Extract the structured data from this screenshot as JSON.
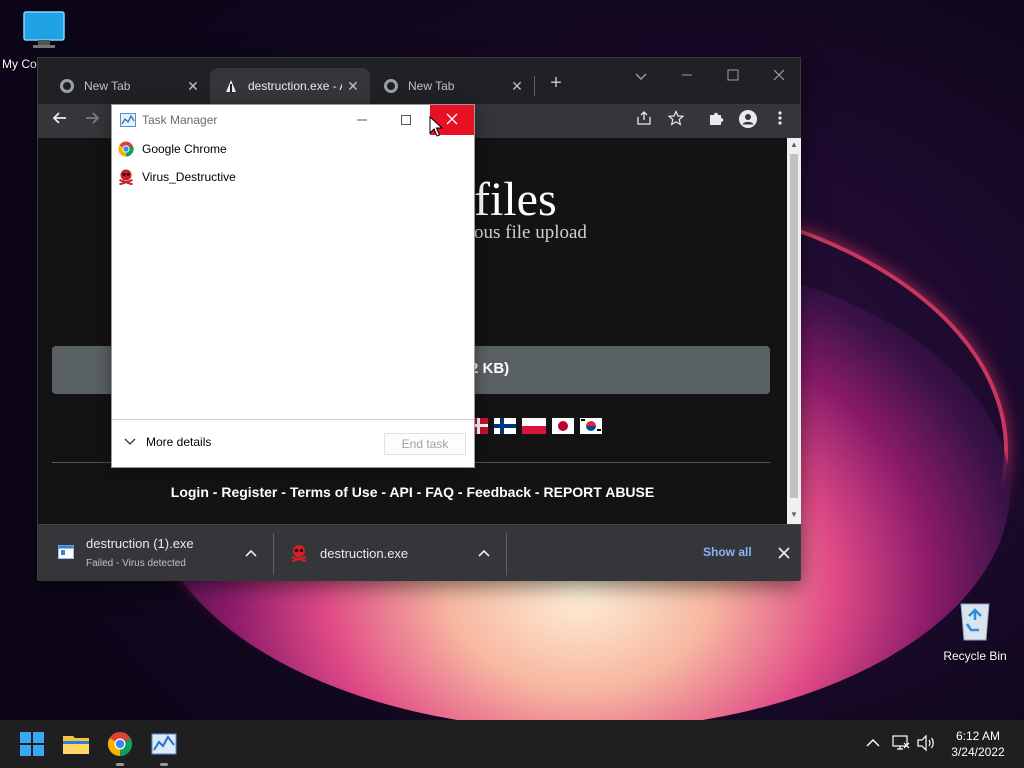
{
  "desktop": {
    "icons": [
      {
        "label": "My Co"
      },
      {
        "label": "Recycle Bin"
      }
    ]
  },
  "chrome": {
    "tabs": [
      {
        "title": "New Tab",
        "close": "✕"
      },
      {
        "title": "destruction.exe - A",
        "close": "✕"
      },
      {
        "title": "New Tab",
        "close": "✕"
      }
    ],
    "new_tab": "+",
    "page": {
      "title_partial": "files",
      "subtitle_partial": "ous file upload",
      "upload_text_partial": "2 KB)",
      "footer_links": [
        "Login",
        "Register",
        "Terms of Use",
        "API",
        "FAQ",
        "Feedback",
        "REPORT ABUSE"
      ],
      "footer_separator": " - "
    },
    "downloads": {
      "items": [
        {
          "name": "destruction (1).exe",
          "status": "Failed - Virus detected"
        },
        {
          "name": "destruction.exe",
          "status": ""
        }
      ],
      "show_all": "Show all"
    }
  },
  "task_manager": {
    "title": "Task Manager",
    "processes": [
      {
        "name": "Google Chrome",
        "icon": "chrome-icon"
      },
      {
        "name": "Virus_Destructive",
        "icon": "skull-icon"
      }
    ],
    "more_details": "More details",
    "end_task": "End task"
  },
  "taskbar": {
    "time": "6:12 AM",
    "date": "3/24/2022"
  },
  "colors": {
    "close_red": "#e81123",
    "chrome_dark": "#202124",
    "show_all_blue": "#8ab4f8"
  }
}
